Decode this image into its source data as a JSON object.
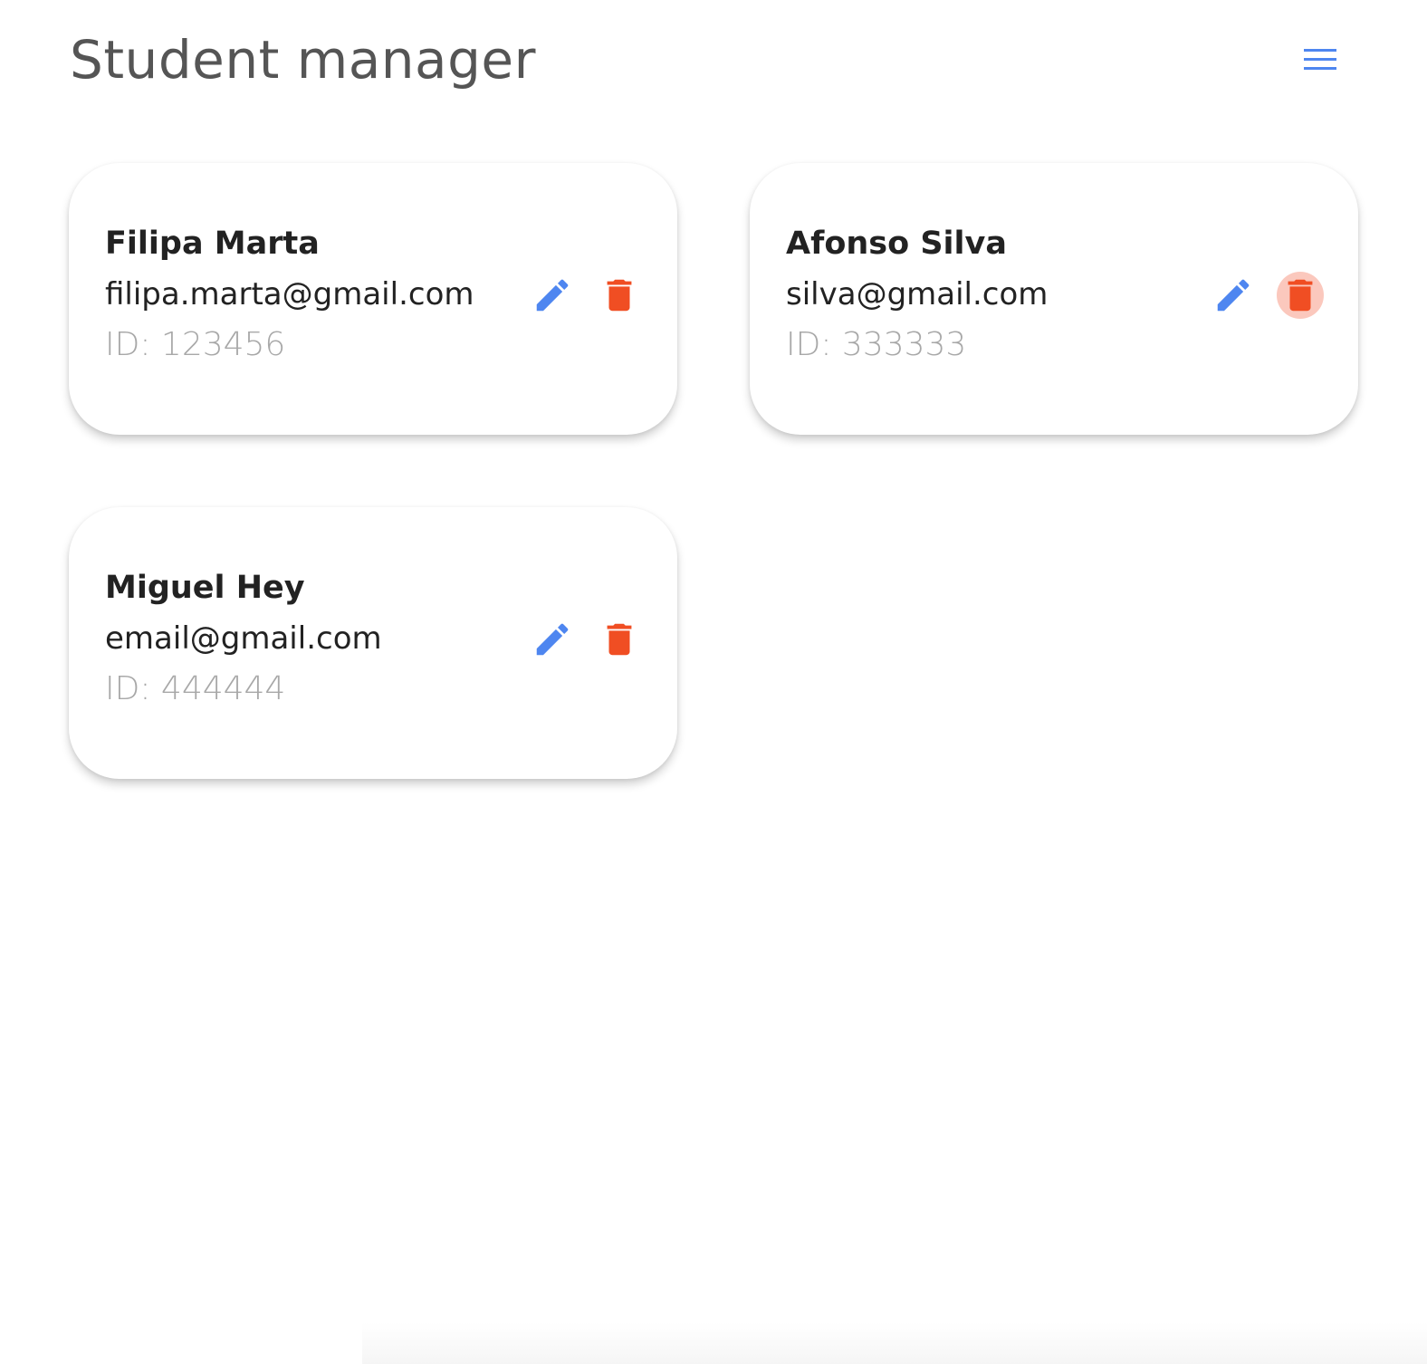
{
  "header": {
    "title": "Student manager",
    "menu_icon": "hamburger-menu-icon"
  },
  "colors": {
    "accent": "#4e86f0",
    "delete": "#f04e23",
    "delete_hover_bg": "#fbc8bd",
    "title": "#555555",
    "id_text": "#a8a8a8"
  },
  "students": [
    {
      "name": "Filipa Marta",
      "email": "filipa.marta@gmail.com",
      "id_label": "ID: 123456",
      "edit_icon": "pencil-icon",
      "delete_icon": "trash-icon",
      "delete_hovered": false
    },
    {
      "name": "Afonso Silva",
      "email": "silva@gmail.com",
      "id_label": "ID: 333333",
      "edit_icon": "pencil-icon",
      "delete_icon": "trash-icon",
      "delete_hovered": true
    },
    {
      "name": "Miguel Hey",
      "email": "email@gmail.com",
      "id_label": "ID: 444444",
      "edit_icon": "pencil-icon",
      "delete_icon": "trash-icon",
      "delete_hovered": false
    }
  ]
}
